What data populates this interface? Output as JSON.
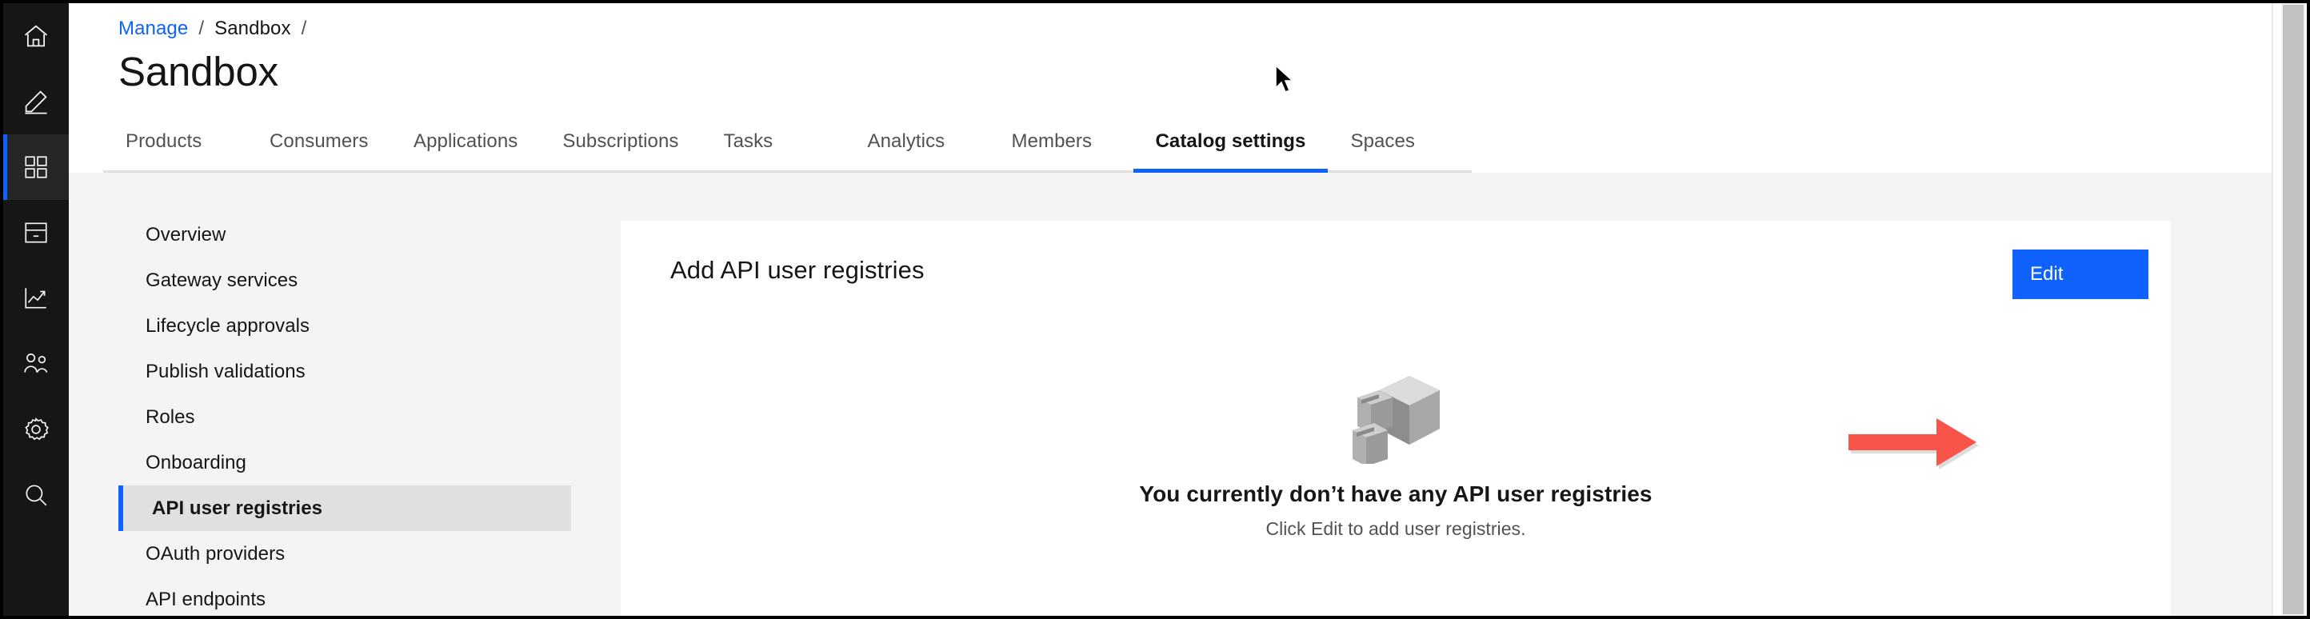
{
  "rail": {
    "items": [
      {
        "name": "home-icon",
        "label": "Home"
      },
      {
        "name": "edit-icon",
        "label": "Edit"
      },
      {
        "name": "grid-icon",
        "label": "Manage",
        "active": true
      },
      {
        "name": "drawer-icon",
        "label": "Catalogs"
      },
      {
        "name": "analytics-icon",
        "label": "Analytics"
      },
      {
        "name": "users-icon",
        "label": "Members"
      },
      {
        "name": "gear-icon",
        "label": "Settings"
      },
      {
        "name": "search-icon",
        "label": "Search"
      }
    ]
  },
  "breadcrumb": {
    "link": "Manage",
    "sep1": "/",
    "current": "Sandbox",
    "sep2": "/"
  },
  "page": {
    "title": "Sandbox"
  },
  "tabs": [
    {
      "label": "Products",
      "active": false
    },
    {
      "label": "Consumers",
      "active": false
    },
    {
      "label": "Applications",
      "active": false
    },
    {
      "label": "Subscriptions",
      "active": false
    },
    {
      "label": "Tasks",
      "active": false
    },
    {
      "label": "Analytics",
      "active": false
    },
    {
      "label": "Members",
      "active": false
    },
    {
      "label": "Catalog settings",
      "active": true
    },
    {
      "label": "Spaces",
      "active": false
    }
  ],
  "subnav": [
    {
      "label": "Overview",
      "selected": false
    },
    {
      "label": "Gateway services",
      "selected": false
    },
    {
      "label": "Lifecycle approvals",
      "selected": false
    },
    {
      "label": "Publish validations",
      "selected": false
    },
    {
      "label": "Roles",
      "selected": false
    },
    {
      "label": "Onboarding",
      "selected": false
    },
    {
      "label": "API user registries",
      "selected": true
    },
    {
      "label": "OAuth providers",
      "selected": false
    },
    {
      "label": "API endpoints",
      "selected": false
    }
  ],
  "card": {
    "title": "Add API user registries",
    "edit_label": "Edit"
  },
  "empty_state": {
    "illustration": "filing-cabinet-illustration",
    "title": "You currently don’t have any API user registries",
    "subtitle": "Click Edit to add user registries."
  },
  "annotation": {
    "arrow": "red-arrow-pointing-to-edit-button",
    "color": "#f9544a"
  },
  "colors": {
    "accent_blue": "#0f62fe",
    "rail_dark": "#161616",
    "body_bg": "#f4f4f4",
    "card_bg": "#ffffff",
    "selected_nav_bg": "#e0e0e0",
    "annotation_red": "#f9544a"
  }
}
